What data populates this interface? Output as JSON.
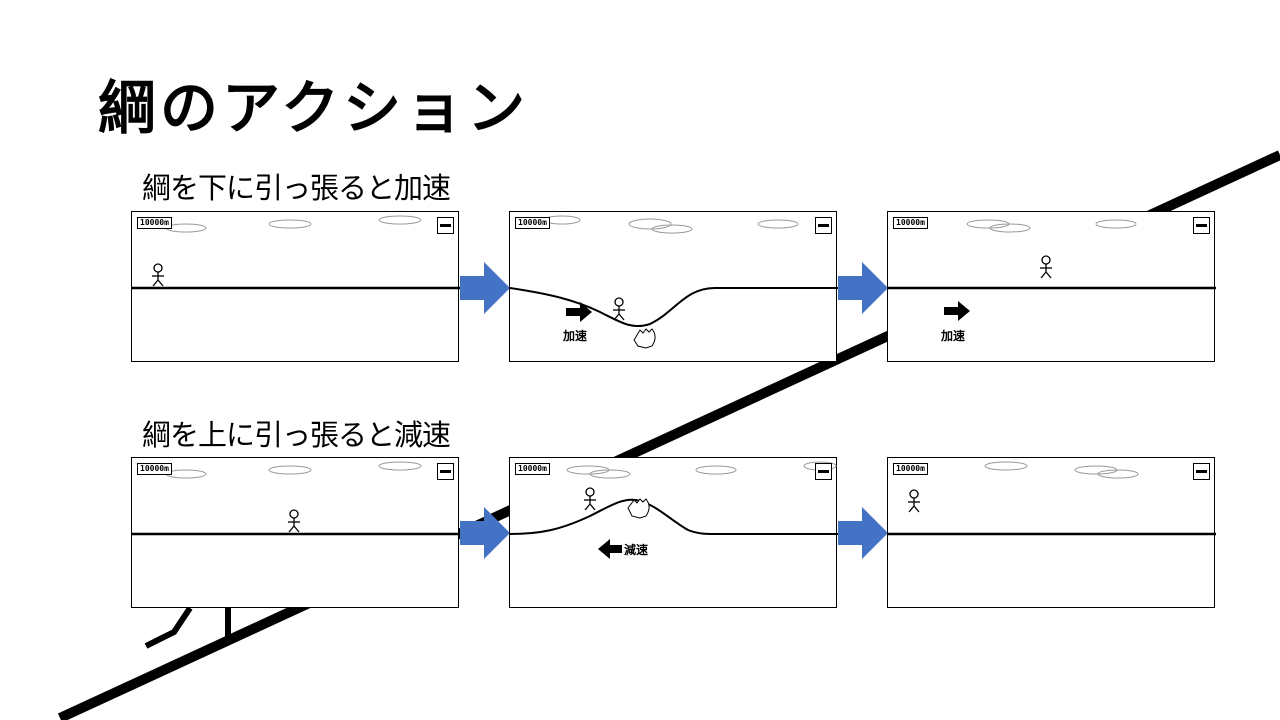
{
  "title": "綱のアクション",
  "rows": [
    {
      "heading": "綱を下に引っ張ると加速",
      "panels": [
        {
          "distance": "10000m"
        },
        {
          "distance": "10000m",
          "speed_label": "加速"
        },
        {
          "distance": "10000m",
          "speed_label": "加速"
        }
      ]
    },
    {
      "heading": "綱を上に引っ張ると減速",
      "panels": [
        {
          "distance": "10000m"
        },
        {
          "distance": "10000m",
          "speed_label": "減速"
        },
        {
          "distance": "10000m"
        }
      ]
    }
  ],
  "colors": {
    "flow_arrow": "#4472C4",
    "line": "#000000",
    "cloud": "#999999"
  }
}
